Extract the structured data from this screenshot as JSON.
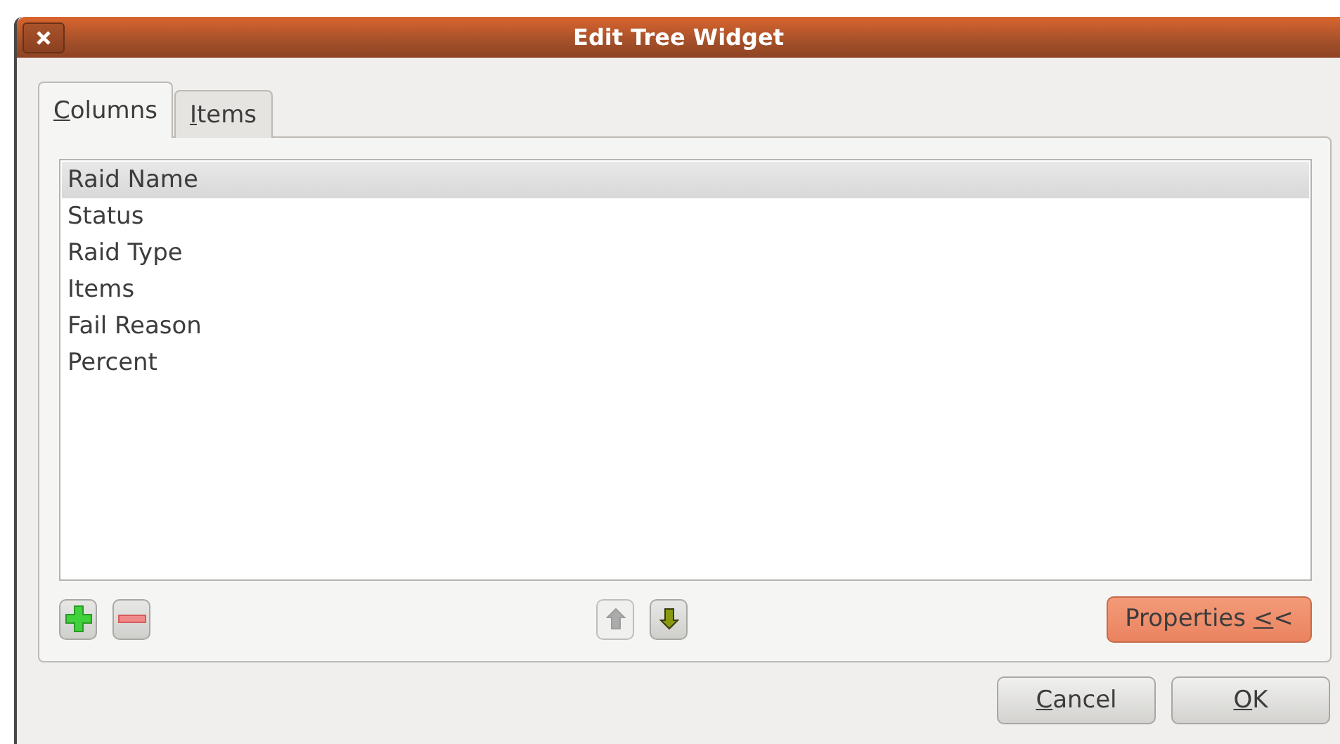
{
  "window": {
    "title": "Edit Tree Widget"
  },
  "tabs": [
    {
      "label": "Columns",
      "mnemonic_underlined": true,
      "selected": true
    },
    {
      "label": "Items",
      "mnemonic_underlined": true,
      "selected": false
    }
  ],
  "columns_list": [
    {
      "label": "Raid Name",
      "selected": true
    },
    {
      "label": "Status",
      "selected": false
    },
    {
      "label": "Raid Type",
      "selected": false
    },
    {
      "label": "Items",
      "selected": false
    },
    {
      "label": "Fail Reason",
      "selected": false
    },
    {
      "label": "Percent",
      "selected": false
    }
  ],
  "list_tools": [
    {
      "kind": "add",
      "disabled": false
    },
    {
      "kind": "remove",
      "disabled": false
    },
    {
      "kind": "up",
      "disabled": true
    },
    {
      "kind": "down",
      "disabled": false
    }
  ],
  "properties_button": {
    "label": "Properties <<",
    "mnemonic_underlined": true,
    "highlighted": true
  },
  "buttons": [
    {
      "label": "Cancel",
      "mnemonic_underlined": true
    },
    {
      "label": "OK",
      "mnemonic_underlined": true
    }
  ]
}
